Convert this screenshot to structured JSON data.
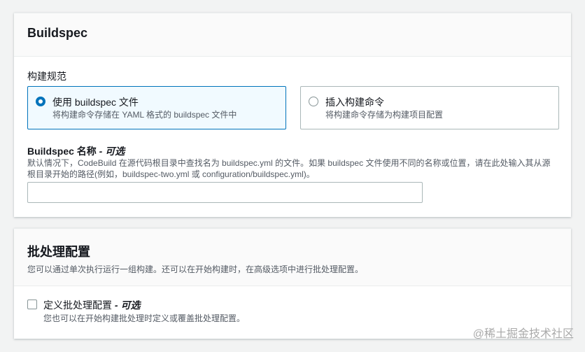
{
  "buildspec": {
    "title": "Buildspec",
    "section_label": "构建规范",
    "options": [
      {
        "title": "使用 buildspec 文件",
        "description": "将构建命令存储在 YAML 格式的 buildspec 文件中",
        "selected": true
      },
      {
        "title": "插入构建命令",
        "description": "将构建命令存储为构建项目配置",
        "selected": false
      }
    ],
    "name_field": {
      "label": "Buildspec 名称",
      "optional": " - 可选",
      "description": "默认情况下，CodeBuild 在源代码根目录中查找名为 buildspec.yml 的文件。如果 buildspec 文件使用不同的名称或位置，请在此处输入其从源根目录开始的路径(例如，buildspec-two.yml 或 configuration/buildspec.yml)。",
      "value": ""
    }
  },
  "batch": {
    "title": "批处理配置",
    "description": "您可以通过单次执行运行一组构建。还可以在开始构建时，在高级选项中进行批处理配置。",
    "checkbox": {
      "label": "定义批处理配置",
      "optional": " - 可选",
      "description": "您也可以在开始构建批处理时定义或覆盖批处理配置。",
      "checked": false
    }
  },
  "watermark": "@稀土掘金技术社区",
  "colors": {
    "accent": "#0073bb",
    "selected_bg": "#f1faff",
    "border": "#aab7b8",
    "muted_text": "#545b64"
  }
}
